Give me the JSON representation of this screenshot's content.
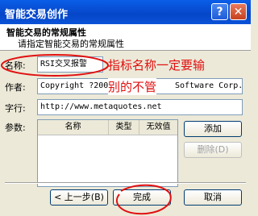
{
  "window": {
    "title": "智能交易创作"
  },
  "header": {
    "title": "智能交易的常规属性",
    "subtitle": "请指定智能交易的常规属性"
  },
  "form": {
    "name_label": "名称:",
    "name_value": "RSI交叉报警",
    "author_label": "作者:",
    "author_value": "Copyright ?200",
    "author_tail": "Software Corp.",
    "link_label": "字行:",
    "link_value": "http://www.metaquotes.net",
    "params_label": "参数:"
  },
  "params_table": {
    "columns": [
      "名称",
      "类型",
      "无效值"
    ]
  },
  "buttons": {
    "add": "添加",
    "delete": "删除(D)",
    "back": "< 上一步(B)",
    "finish": "完成",
    "cancel": "取消"
  },
  "annotations": {
    "name_note": "指标名称一定要输",
    "author_note": "别的不管"
  },
  "colors": {
    "annotation": "#e01010",
    "titlebar": "#0a52d8"
  }
}
